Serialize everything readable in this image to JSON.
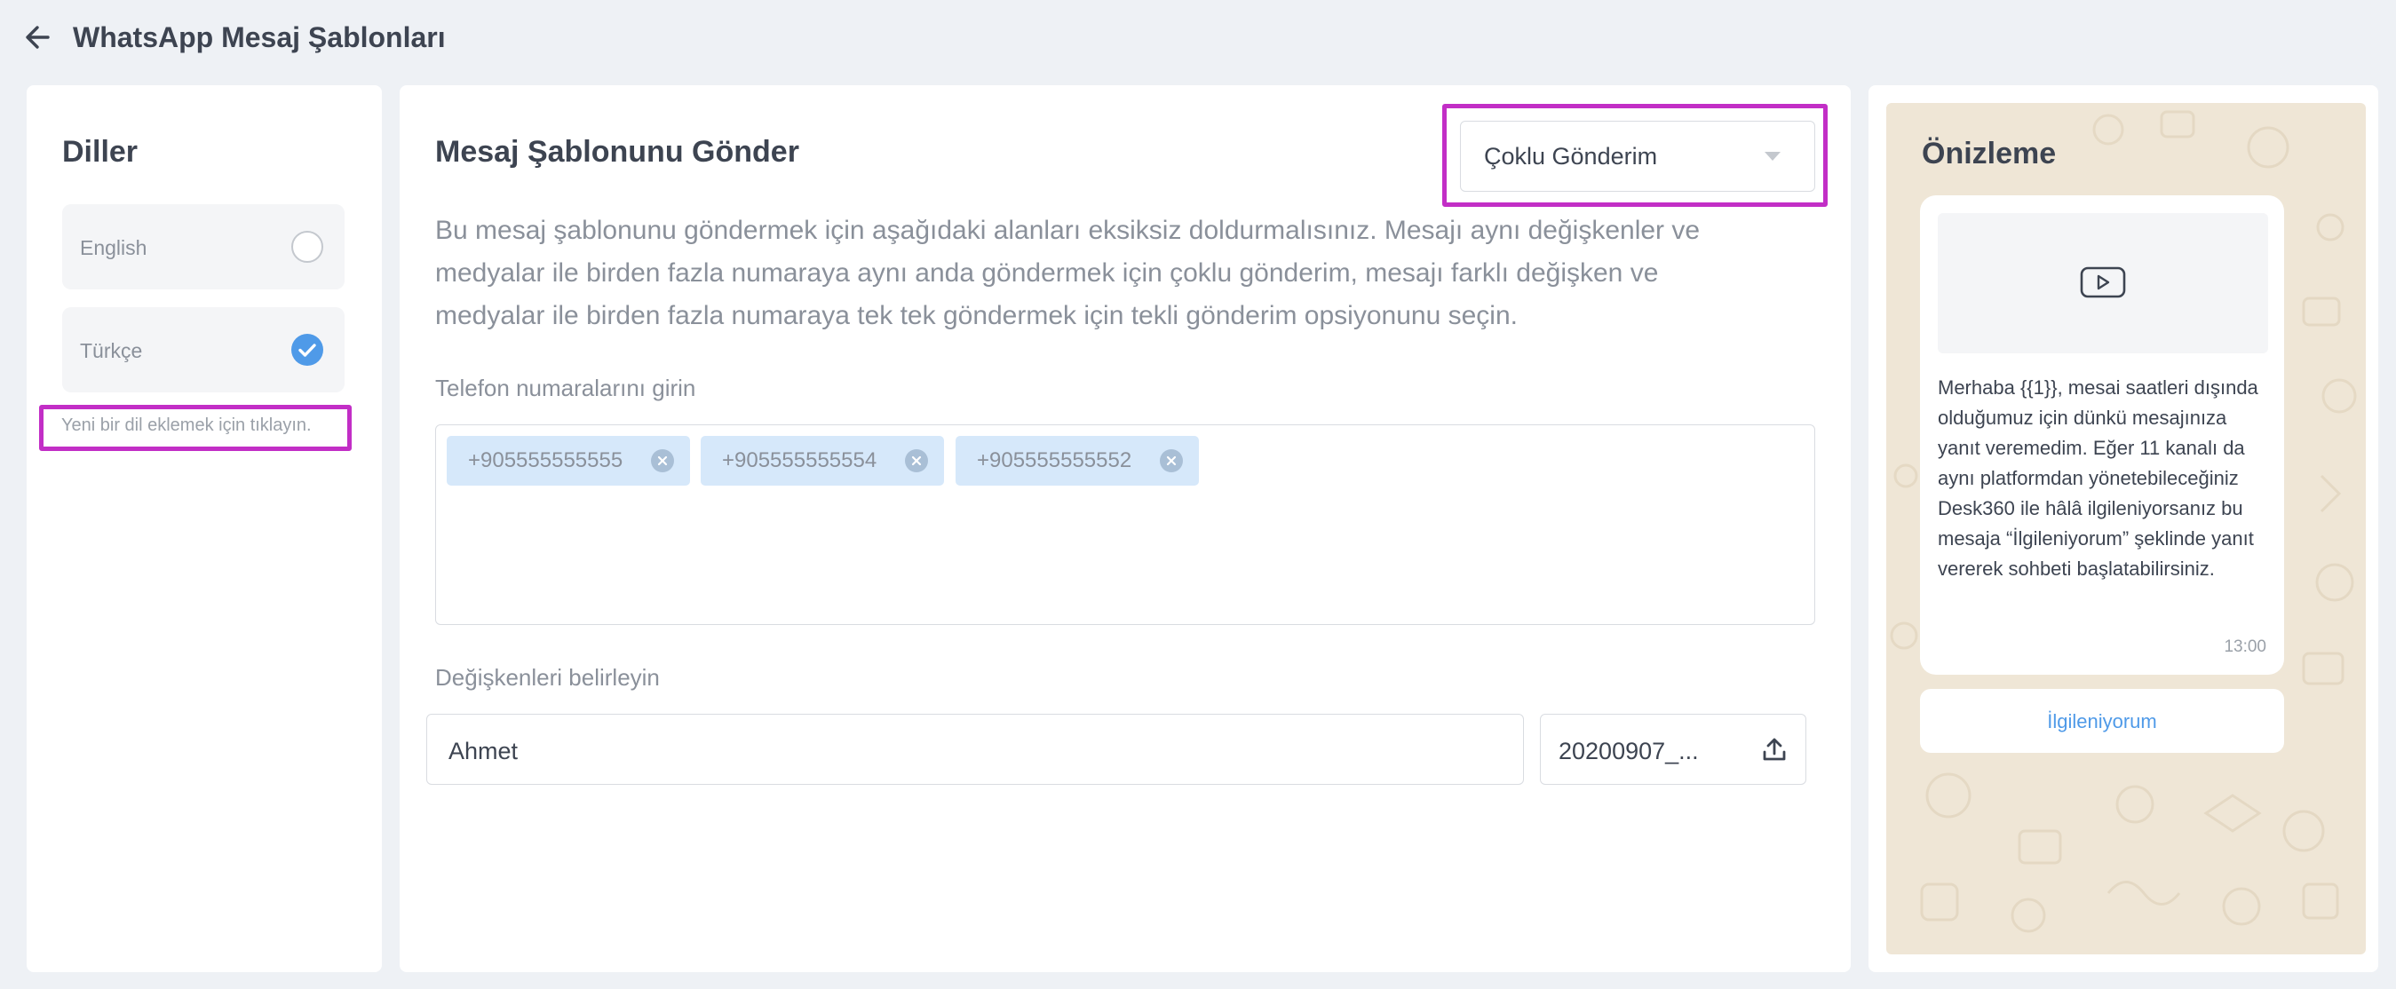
{
  "header": {
    "title": "WhatsApp Mesaj Şablonları",
    "back_icon": "arrow-left-icon"
  },
  "languages": {
    "title": "Diller",
    "items": [
      {
        "label": "English",
        "selected": false
      },
      {
        "label": "Türkçe",
        "selected": true
      }
    ],
    "add_language_hint": "Yeni bir dil eklemek için tıklayın.",
    "accent_color": "#c22ec6"
  },
  "main": {
    "title": "Mesaj Şablonunu Gönder",
    "send_type": {
      "value": "Çoklu Gönderim"
    },
    "description": "Bu mesaj şablonunu göndermek için aşağıdaki alanları eksiksiz doldurmalısınız. Mesajı aynı değişkenler ve medyalar ile birden fazla numaraya aynı anda göndermek için çoklu gönderim, mesajı farklı değişken ve medyalar ile birden fazla numaraya tek tek göndermek için tekli gönderim opsiyonunu seçin.",
    "phones_label": "Telefon numaralarını girin",
    "phones": [
      "+905555555555",
      "+905555555554",
      "+905555555552"
    ],
    "variables_label": "Değişkenleri belirleyin",
    "variable_value": "Ahmet",
    "file_value": "20200907_..."
  },
  "preview": {
    "title": "Önizleme",
    "message": "Merhaba {{1}}, mesai saatleri dışında olduğumuz için dünkü mesajınıza yanıt veremedim. Eğer 11 kanalı da aynı platformdan yönetebileceğiniz Desk360 ile hâlâ ilgileniyorsanız bu mesaja “İlgileniyorum” şeklinde yanıt vererek sohbeti başlatabilirsiniz.",
    "time": "13:00",
    "button_label": "İlgileniyorum",
    "button_color": "#4f9ae8",
    "background_color": "#efe6d6"
  }
}
